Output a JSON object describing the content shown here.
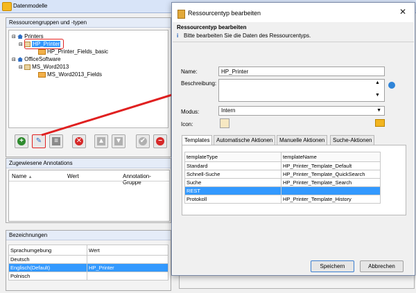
{
  "app": {
    "title": "Datenmodelle"
  },
  "left_panel": {
    "title": "Ressourcengruppen und -typen",
    "tree": [
      {
        "label": "Printers"
      },
      {
        "label": "HP_Printer"
      },
      {
        "label": "HP_Printer_Fields_basic"
      },
      {
        "label": "OfficeSoftware"
      },
      {
        "label": "MS_Word2013"
      },
      {
        "label": "MS_Word2013_Fields"
      }
    ]
  },
  "toolbar": {
    "add": "+",
    "edit": "✎",
    "list": "≡",
    "delete": "✕",
    "up": "▲",
    "down": "▼",
    "check": "✔",
    "remove": "−"
  },
  "annotations": {
    "title": "Zugewiesene Annotations",
    "col_name": "Name",
    "col_sort": "▲",
    "col_value": "Wert",
    "col_group": "Annotation-Gruppe"
  },
  "designations": {
    "title": "Bezeichnungen",
    "col_lang": "Sprachumgebung",
    "col_value": "Wert",
    "rows": [
      {
        "lang": "Deutsch",
        "value": ""
      },
      {
        "lang": "Englisch(Default)",
        "value": "HP_Printer"
      },
      {
        "lang": "Polnisch",
        "value": ""
      }
    ]
  },
  "dialog": {
    "window_title": "Ressourcentyp bearbeiten",
    "close": "✕",
    "heading": "Ressourcentyp bearbeiten",
    "info_icon": "i",
    "subheading": "Bitte bearbeiten Sie die Daten des Ressourcentyps.",
    "name_label": "Name:",
    "name_value": "HP_Printer",
    "desc_label": "Beschreibung:",
    "desc_value": "",
    "mode_label": "Modus:",
    "mode_value": "Intern",
    "icon_label": "Icon:",
    "tabs": [
      "Templates",
      "Automatische Aktionen",
      "Manuelle Aktionen",
      "Suche-Aktionen"
    ],
    "table_header": {
      "type": "templateType",
      "name": "templateName"
    },
    "table_rows": [
      {
        "type": "Standard",
        "name": "HP_Printer_Template_Default"
      },
      {
        "type": "Schnell-Suche",
        "name": "HP_Printer_Template_QuickSearch"
      },
      {
        "type": "Suche",
        "name": "HP_Printer_Template_Search"
      },
      {
        "type": "REST",
        "name": ""
      },
      {
        "type": "Protokoll",
        "name": "HP_Printer_Template_History"
      }
    ],
    "save_label": "Speichern",
    "cancel_label": "Abbrechen"
  },
  "colors": {
    "selection": "#3399ff",
    "annotation_arrow": "#e02020",
    "title_bar": "#d8e4f8"
  }
}
